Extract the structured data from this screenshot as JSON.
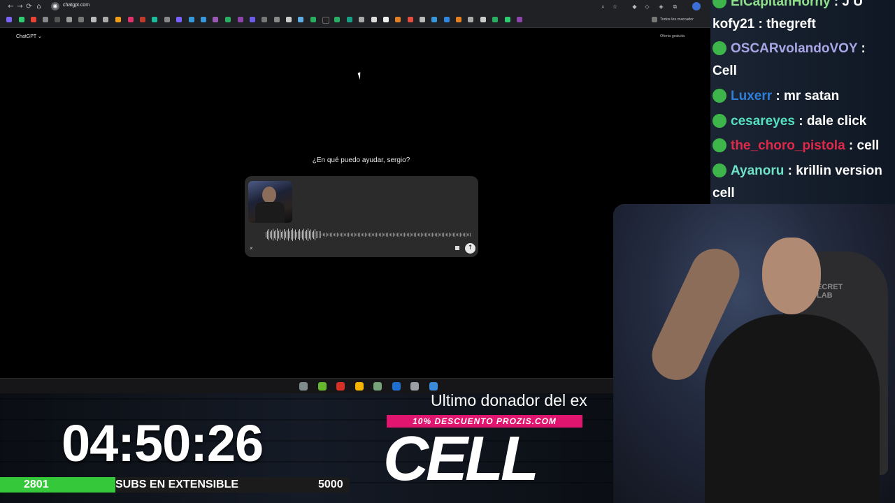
{
  "browser": {
    "url": "chatgpt.com",
    "all_bookmarks": "Todos los marcador",
    "nav": {
      "back": "←",
      "forward": "→",
      "reload": "⟳",
      "home": "⌂"
    },
    "toolbar_icons": [
      "zoom-icon",
      "star-icon",
      "extension-icon",
      "profile-icon"
    ]
  },
  "chatgpt": {
    "title": "ChatGPT ⌄",
    "offer": "Oferta gratuita",
    "greeting": "¿En qué puedo ayudar, sergio?",
    "close_label": "×",
    "send_label": "↑"
  },
  "taskbar": {
    "colors": [
      "#7f8c8d",
      "#65b82e",
      "#d93025",
      "#f4b400",
      "#77a37a",
      "#1f6fd0",
      "#9aa0a6",
      "#3a8bd8"
    ]
  },
  "overlay": {
    "timer": "04:50:26",
    "subs_current": "2801",
    "subs_label": "SUBS EN EXTENSIBLE",
    "subs_goal": "5000",
    "subs_progress": 0.33,
    "donor_label": "Ultimo donador del ex",
    "promo": "10% DESCUENTO PROZIS.COM",
    "donor_name": "CELL"
  },
  "chat": {
    "messages": [
      {
        "user": "ElCapitanHorny",
        "text": " : J U",
        "color": "#8fe08a"
      },
      {
        "user": "kofy21",
        "text": " : thegreft",
        "color": "#ffffff"
      },
      {
        "user": "OSCARvolandoVOY",
        "text": " : Cell",
        "color": "#a9a6e6"
      },
      {
        "user": "Luxerr",
        "text": " : mr satan",
        "color": "#2f7fd8"
      },
      {
        "user": "cesareyes",
        "text": " : dale click",
        "color": "#55e0c0"
      },
      {
        "user": "the_choro_pistola",
        "text": " : cell",
        "color": "#e0294a"
      },
      {
        "user": "Ayanoru",
        "text": " : krillin version cell",
        "color": "#6fe3c8"
      }
    ]
  },
  "webcam": {
    "chair_text": "ECRET\nLAB"
  }
}
